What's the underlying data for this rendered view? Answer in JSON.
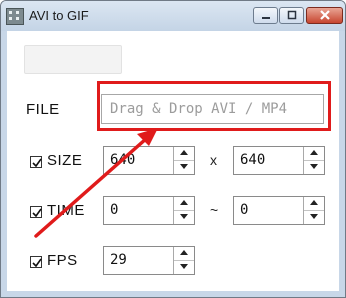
{
  "window": {
    "title": "AVI to GIF",
    "controls": {
      "minimize": "minimize",
      "maximize": "maximize",
      "close": "close"
    }
  },
  "form": {
    "file": {
      "label": "FILE",
      "placeholder": "Drag & Drop AVI / MP4"
    },
    "size": {
      "label": "SIZE",
      "checked": true,
      "width": "640",
      "height": "640",
      "separator": "x"
    },
    "time": {
      "label": "TIME",
      "checked": true,
      "start": "0",
      "end": "0",
      "separator": "~"
    },
    "fps": {
      "label": "FPS",
      "checked": true,
      "value": "29"
    }
  },
  "colors": {
    "annotation": "#e01b1b",
    "titlebar": "#c8d7e8"
  },
  "icons": {
    "app": "app-icon",
    "minimize": "minimize-icon",
    "maximize": "maximize-icon",
    "close": "close-icon",
    "check": "check-icon",
    "spin_up": "arrow-up-icon",
    "spin_down": "arrow-down-icon"
  }
}
